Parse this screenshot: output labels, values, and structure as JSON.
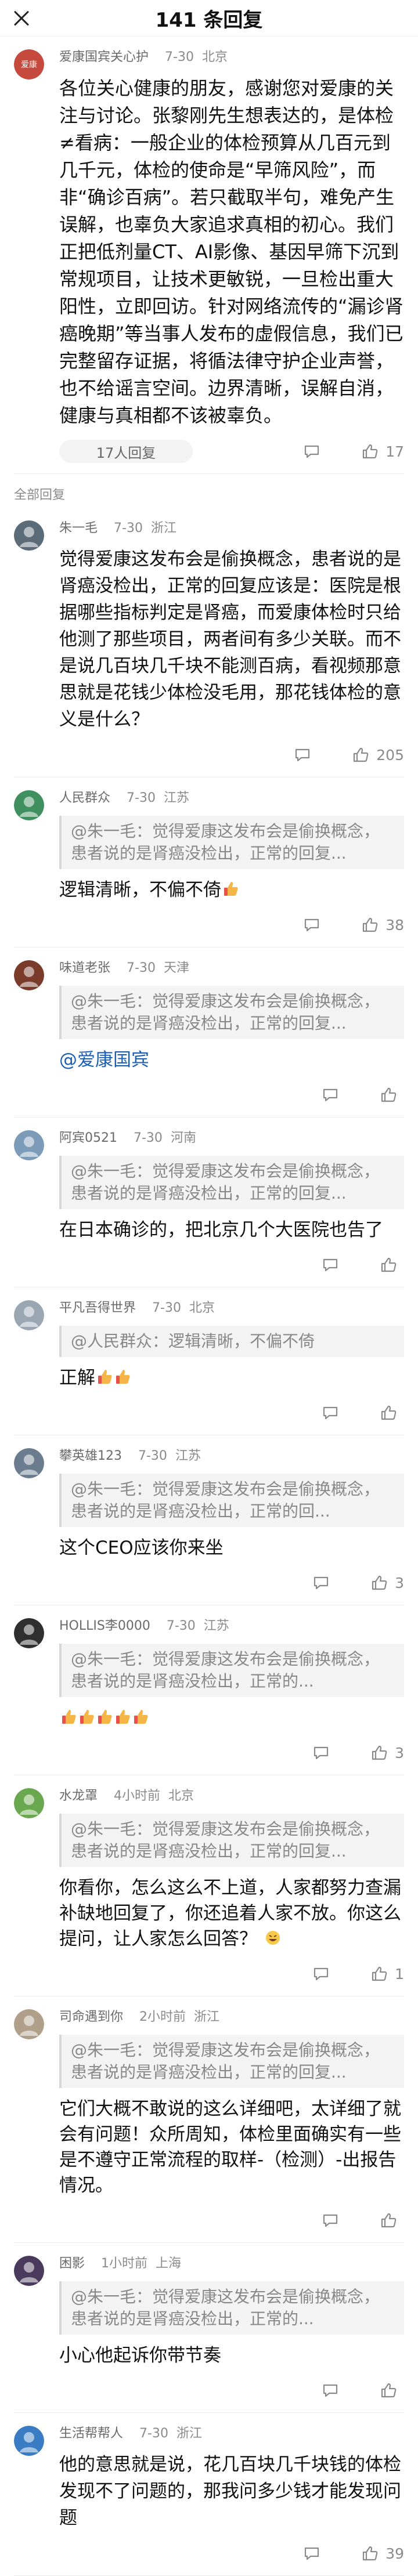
{
  "header": {
    "title": "141 条回复",
    "close_icon": "close-icon"
  },
  "op": {
    "name": "爱康国宾关心护",
    "time": "7-30",
    "loc": "北京",
    "avatar_color": "#c54a3d",
    "text": "各位关心健康的朋友，感谢您对爱康的关注与讨论。张黎刚先生想表达的，是体检≠看病：一般企业的体检预算从几百元到几千元，体检的使命是“早筛风险”，而非“确诊百病”。若只截取半句，难免产生误解，也辜负大家追求真相的初心。我们正把低剂量CT、AI影像、基因早筛下沉到常规项目，让技术更敏锐，一旦检出重大阳性，立即回访。针对网络流传的“漏诊肾癌晚期”等当事人发布的虚假信息，我们已完整留存证据，将循法律守护企业声誉，也不给谣言空间。边界清晰，误解自消，健康与真相都不该被辜负。",
    "sub_replies": "17人回复",
    "likes": "17"
  },
  "section_label": "全部回复",
  "comments": [
    {
      "name": "朱一毛",
      "time": "7-30",
      "loc": "浙江",
      "avatar_color": "#5b6b78",
      "text": "觉得爱康这发布会是偷换概念，患者说的是肾癌没检出，正常的回复应该是：医院是根据哪些指标判定是肾癌，而爱康体检时只给他测了那些项目，两者间有多少关联。而不是说几百块几千块不能测百病，看视频那意思就是花钱少体检没毛用，那花钱体检的意义是什么？",
      "likes": "205"
    },
    {
      "name": "人民群众",
      "time": "7-30",
      "loc": "江苏",
      "avatar_color": "#3f8f5f",
      "quote": "@朱一毛：觉得爱康这发布会是偷换概念，患者说的是肾癌没检出，正常的回复...",
      "reply": "逻辑清晰，不偏不倚",
      "likes": "38"
    },
    {
      "name": "味道老张",
      "time": "7-30",
      "loc": "天津",
      "avatar_color": "#7a3b2b",
      "quote": "@朱一毛：觉得爱康这发布会是偷换概念，患者说的是肾癌没检出，正常的回复...",
      "reply": "@爱康国宾",
      "likes": ""
    },
    {
      "name": "阿宾0521",
      "time": "7-30",
      "loc": "河南",
      "avatar_color": "#7c9bb8",
      "quote": "@朱一毛：觉得爱康这发布会是偷换概念，患者说的是肾癌没检出，正常的回复...",
      "reply": "在日本确诊的，把北京几个大医院也告了",
      "likes": ""
    },
    {
      "name": "平凡吾得世界",
      "time": "7-30",
      "loc": "北京",
      "avatar_color": "#9aa7b3",
      "quote": "@人民群众：逻辑清晰，不偏不倚",
      "reply": "正解",
      "likes": ""
    },
    {
      "name": "攀英雄123",
      "time": "7-30",
      "loc": "江苏",
      "avatar_color": "#6b7c8f",
      "quote": "@朱一毛：觉得爱康这发布会是偷换概念，患者说的是肾癌没检出，正常的回...",
      "reply": "这个CEO应该你来坐",
      "likes": "3"
    },
    {
      "name": "HOLLIS李0000",
      "time": "7-30",
      "loc": "江苏",
      "avatar_color": "#2f2f2f",
      "quote": "@朱一毛：觉得爱康这发布会是偷换概念，患者说的是肾癌没检出，正常的...",
      "reply": "",
      "likes": "3"
    },
    {
      "name": "水龙罩",
      "time": "4小时前",
      "loc": "北京",
      "avatar_color": "#6aa84f",
      "quote": "@朱一毛：觉得爱康这发布会是偷换概念，患者说的是肾癌没检出，正常的回复...",
      "reply": "你看你，怎么这么不上道，人家都努力查漏补缺地回复了，你还追着人家不放。你这么提问，让人家怎么回答？",
      "likes": "1"
    },
    {
      "name": "司命遇到你",
      "time": "2小时前",
      "loc": "浙江",
      "avatar_color": "#b0a08a",
      "quote": "@朱一毛：觉得爱康这发布会是偷换概念，患者说的是肾癌没检出，正常的回复...",
      "reply": "它们大概不敢说的这么详细吧，太详细了就会有问题！众所周知，体检里面确实有一些是不遵守正常流程的取样-（检测）-出报告情况。",
      "likes": ""
    },
    {
      "name": "困影",
      "time": "1小时前",
      "loc": "上海",
      "avatar_color": "#4a3b5c",
      "quote": "@朱一毛：觉得爱康这发布会是偷换概念，患者说的是肾癌没检出，正常的...",
      "reply": "小心他起诉你带节奏",
      "likes": ""
    },
    {
      "name": "生活帮帮人",
      "time": "7-30",
      "loc": "浙江",
      "avatar_color": "#3b7dc4",
      "text": "他的意思就是说，花几百块几千块钱的体检发现不了问题的，那我问多少钱才能发现问题",
      "likes": "39"
    }
  ]
}
